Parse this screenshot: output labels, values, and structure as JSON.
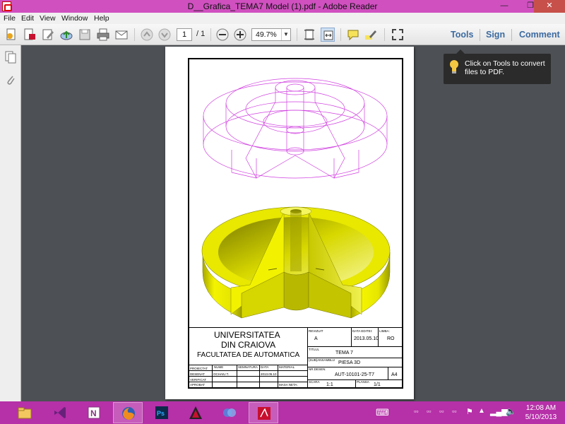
{
  "window": {
    "title": "D__Grafica_TEMA7 Model (1).pdf - Adobe Reader",
    "minimize": "—",
    "restore": "❐",
    "close": "✕"
  },
  "menu": {
    "items": [
      "File",
      "Edit",
      "View",
      "Window",
      "Help"
    ]
  },
  "toolbar": {
    "page_current": "1",
    "page_total": "/ 1",
    "zoom": "49.7%",
    "tools_label": "Tools",
    "sign_label": "Sign",
    "comment_label": "Comment"
  },
  "tooltip": {
    "text": "Click on Tools to convert files to PDF."
  },
  "document": {
    "title_block": {
      "university_line1": "UNIVERSITATEA",
      "university_line2": "DIN CRAIOVA",
      "faculty": "FACULTATEA DE AUTOMATICA",
      "revizuit_label": "REVIZUIT",
      "revizuit_value": "A",
      "data_label": "DATA EDITEI:",
      "data_value": "2013.05.10",
      "limba_label": "LIMBA:",
      "limba_value": "RO",
      "titlu_label": "TITLUL",
      "titlu_value": "TEMA 7",
      "subansamblu_label": "(SUB)ANSAMBLU",
      "subansamblu_value": "PIESA 3D",
      "nr_desen_label": "NR.DESEN:",
      "nr_desen_value": "AUT-10101-25-T7",
      "format_value": "A4",
      "scara_label": "SCARA",
      "scara_value": "1:1",
      "plansa_label": "PLANSA",
      "plansa_value": "1/1",
      "col_nume": "NUME",
      "col_semnatura": "SEMNATURA",
      "col_data": "DATA",
      "col_material": "MATERIAL",
      "row_proiectat": "PROIECTAT",
      "row_desenat": "DESENAT",
      "row_verificat": "VERIFICAT",
      "row_aprobat": "APROBAT",
      "desenat_nume": "OCHAIU T.",
      "desenat_data": "2013.05.10",
      "masa_neta": "MASA NETA:"
    }
  },
  "tray": {
    "keyboard": "⌨",
    "time": "12:08 AM",
    "date": "5/10/2013"
  },
  "colors": {
    "titlebar": "#d050c0",
    "taskbar": "#b630a8",
    "accent_blue": "#3b6aa0",
    "wireframe": "#d040e0",
    "solid_yellow": "#e8e800"
  }
}
